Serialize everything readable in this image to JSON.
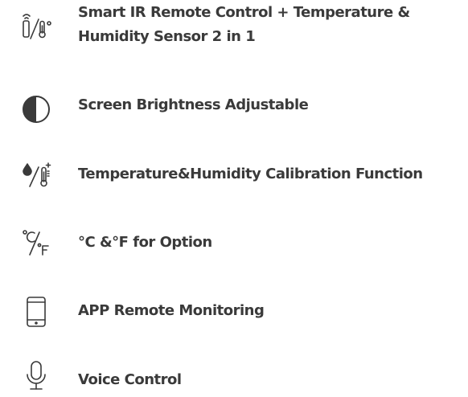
{
  "features": [
    {
      "icon": "remote-thermometer-icon",
      "label_line1": "Smart IR Remote Control + Temperature &",
      "label_line2": "Humidity Sensor 2 in 1"
    },
    {
      "icon": "brightness-icon",
      "label": "Screen Brightness Adjustable"
    },
    {
      "icon": "calibration-icon",
      "label": "Temperature&Humidity Calibration Function"
    },
    {
      "icon": "celsius-fahrenheit-icon",
      "label": "°C &°F for Option"
    },
    {
      "icon": "smartphone-icon",
      "label": "APP Remote Monitoring"
    },
    {
      "icon": "microphone-icon",
      "label": "Voice Control"
    }
  ],
  "colors": {
    "text": "#3a3a3a",
    "icon": "#3a3a3a",
    "background": "#ffffff"
  }
}
